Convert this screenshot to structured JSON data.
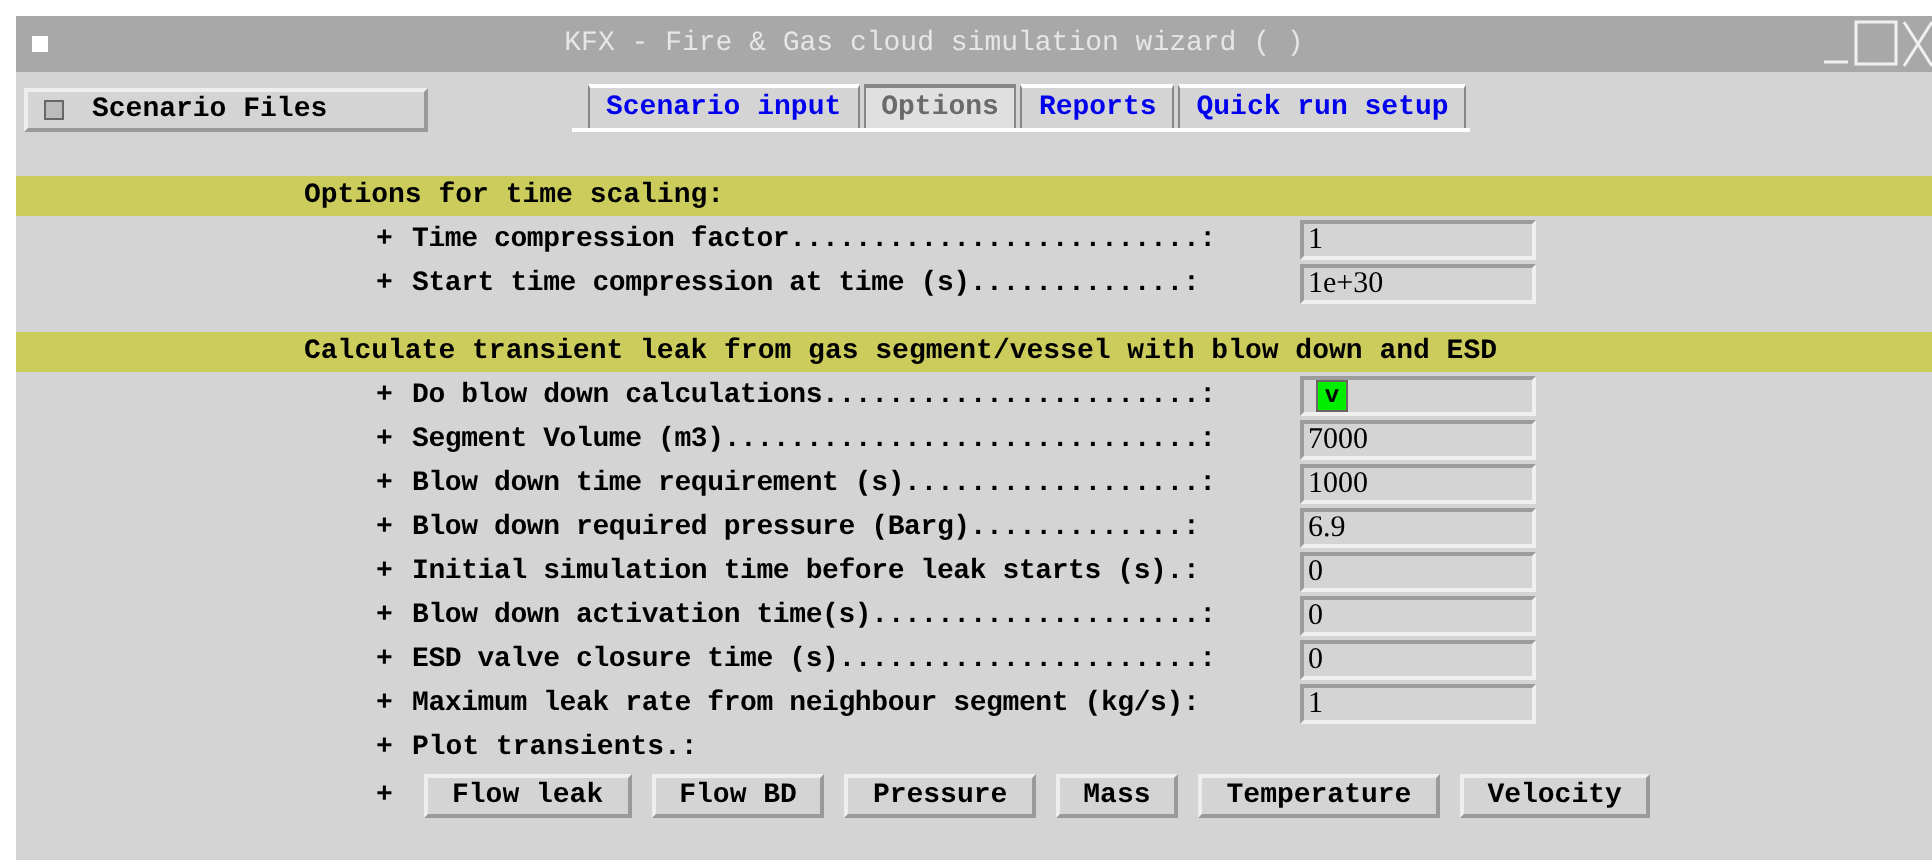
{
  "window": {
    "title": "KFX - Fire & Gas cloud simulation wizard ( )"
  },
  "scenario_button": {
    "label": "Scenario Files"
  },
  "tabs": [
    {
      "label": "Scenario input",
      "selected": false
    },
    {
      "label": "Options",
      "selected": true
    },
    {
      "label": "Reports",
      "selected": false
    },
    {
      "label": "Quick run setup",
      "selected": false
    }
  ],
  "sections": [
    {
      "title": "Options for time scaling:",
      "rows": [
        {
          "kind": "field",
          "bullet": "+",
          "label": "Time compression factor.........................:",
          "value": "1"
        },
        {
          "kind": "field",
          "bullet": "+",
          "label": "Start time compression at time (s).............:",
          "value": "1e+30"
        }
      ]
    },
    {
      "title": "Calculate transient leak from gas segment/vessel with blow down and ESD",
      "rows": [
        {
          "kind": "checkbox",
          "bullet": "+",
          "label": "Do blow down calculations.......................:",
          "checked": true,
          "mark": "v"
        },
        {
          "kind": "field",
          "bullet": "+",
          "label": "Segment Volume (m3).............................:",
          "value": "7000"
        },
        {
          "kind": "field",
          "bullet": "+",
          "label": "Blow down time requirement (s)..................:",
          "value": "1000"
        },
        {
          "kind": "field",
          "bullet": "+",
          "label": "Blow down required pressure (Barg).............:",
          "value": "6.9"
        },
        {
          "kind": "field",
          "bullet": "+",
          "label": "Initial simulation time before leak starts (s).:",
          "value": "0"
        },
        {
          "kind": "field",
          "bullet": "+",
          "label": "Blow down activation time(s)....................:",
          "value": "0"
        },
        {
          "kind": "field",
          "bullet": "+",
          "label": "ESD valve closure time (s)......................:",
          "value": "0"
        },
        {
          "kind": "field",
          "bullet": "+",
          "label": "Maximum leak rate from neighbour segment (kg/s):",
          "value": "1"
        },
        {
          "kind": "text",
          "bullet": "+",
          "label": "Plot transients.:"
        },
        {
          "kind": "buttons",
          "bullet": "+",
          "buttons": [
            "Flow leak",
            "Flow BD",
            "Pressure",
            "Mass",
            "Temperature",
            "Velocity"
          ]
        }
      ]
    }
  ]
}
